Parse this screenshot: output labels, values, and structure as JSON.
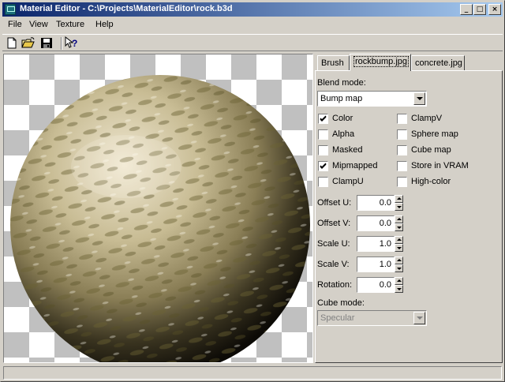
{
  "window": {
    "title": "Material Editor - C:\\Projects\\MaterialEditor\\rock.b3d",
    "controls": {
      "minimize": "_",
      "maximize": "□",
      "close": "×"
    }
  },
  "menu": [
    "File",
    "View",
    "Texture",
    "Help"
  ],
  "toolbar": {
    "icons": [
      "new-document-icon",
      "open-folder-icon",
      "save-disk-icon",
      "context-help-icon"
    ]
  },
  "tabs": [
    {
      "label": "Brush",
      "active": false
    },
    {
      "label": "rockbump.jpg",
      "active": true
    },
    {
      "label": "concrete.jpg",
      "active": false
    }
  ],
  "blend": {
    "label": "Blend mode:",
    "value": "Bump map"
  },
  "flags_left": [
    {
      "label": "Color",
      "checked": true
    },
    {
      "label": "Alpha",
      "checked": false
    },
    {
      "label": "Masked",
      "checked": false
    },
    {
      "label": "Mipmapped",
      "checked": true
    },
    {
      "label": "ClampU",
      "checked": false
    }
  ],
  "flags_right": [
    {
      "label": "ClampV",
      "checked": false
    },
    {
      "label": "Sphere map",
      "checked": false
    },
    {
      "label": "Cube map",
      "checked": false
    },
    {
      "label": "Store in VRAM",
      "checked": false
    },
    {
      "label": "High-color",
      "checked": false
    }
  ],
  "params": [
    {
      "label": "Offset U:",
      "value": "0.0"
    },
    {
      "label": "Offset V:",
      "value": "0.0"
    },
    {
      "label": "Scale U:",
      "value": "1.0"
    },
    {
      "label": "Scale V:",
      "value": "1.0"
    },
    {
      "label": "Rotation:",
      "value": "0.0"
    }
  ],
  "cube": {
    "label": "Cube mode:",
    "value": "Specular",
    "disabled": true
  },
  "colors": {
    "titlebar_start": "#0a246a",
    "titlebar_end": "#a6caf0",
    "face": "#d4d0c8",
    "checker": "#c0c0c0"
  }
}
